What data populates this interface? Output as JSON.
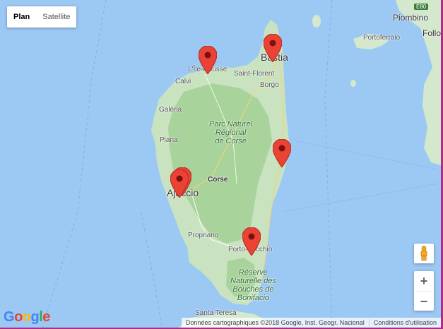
{
  "map_type_control": {
    "plan": "Plan",
    "satellite": "Satellite",
    "selected": "Plan"
  },
  "places": {
    "piombino": "Piombino",
    "follo": "Follo",
    "e80": "E80",
    "portoferraio": "Portoferraio",
    "ile_rousse": "L'Île-Rousse",
    "bastia": "Bastia",
    "saint_florent": "Saint-Florent",
    "calvi": "Calvi",
    "borgo": "Borgo",
    "galeria": "Galéria",
    "piana": "Piana",
    "corse": "Corse",
    "ajaccio": "Ajaccio",
    "propriano": "Propriano",
    "porto_vecchio": "Porto-Vecchio",
    "santa_teresa": "Santa Teresa"
  },
  "parks": {
    "corse_park": [
      "Parc Naturel",
      "Régional",
      "de Corse"
    ],
    "bonifacio_reserve": [
      "Réserve",
      "Naturelle des",
      "Bouches de",
      "Bonifacio"
    ]
  },
  "markers": [
    "L'Île-Rousse",
    "Bastia",
    "Ajaccio",
    "Ajaccio",
    "Porto-Vecchio",
    "east coast"
  ],
  "footer": {
    "attribution": "Données cartographiques ©2018 Google, Inst. Geogr. Nacional",
    "terms": "Conditions d'utilisation"
  },
  "zoom": {
    "in": "+",
    "out": "−"
  },
  "logo": {
    "g1": "G",
    "o1": "o",
    "o2": "o",
    "g2": "g",
    "l": "l",
    "e": "e"
  },
  "colors": {
    "water": "#9cc8f4",
    "land": "#c9e3c1",
    "forest": "#a8d39b",
    "marker": "#ea4335"
  }
}
